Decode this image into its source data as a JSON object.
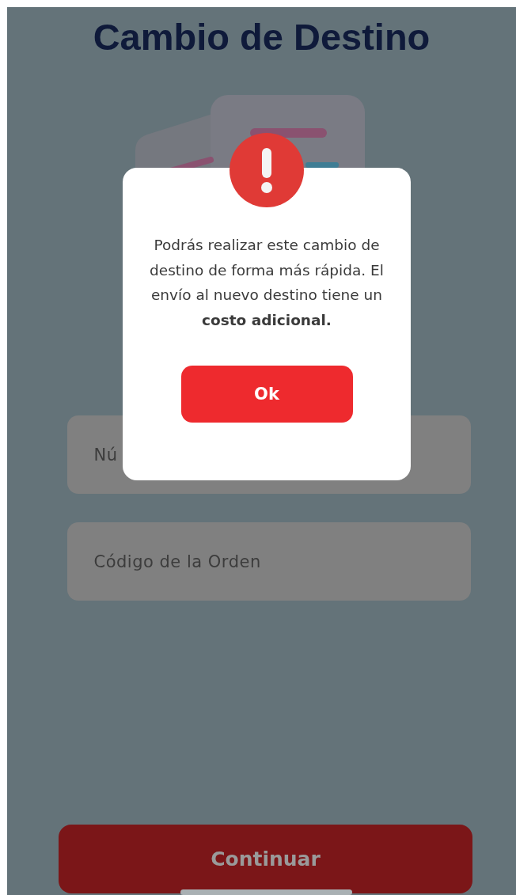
{
  "title": "Cambio de Destino",
  "fields": [
    {
      "placeholder": "Nú"
    },
    {
      "placeholder": "Código de la Orden"
    }
  ],
  "continue_button": "Continuar",
  "dialog": {
    "message": "Podrás realizar este cambio de destino de forma más rápida. El envío al nuevo destino tiene un **costo adicional.**",
    "button": "Ok"
  }
}
